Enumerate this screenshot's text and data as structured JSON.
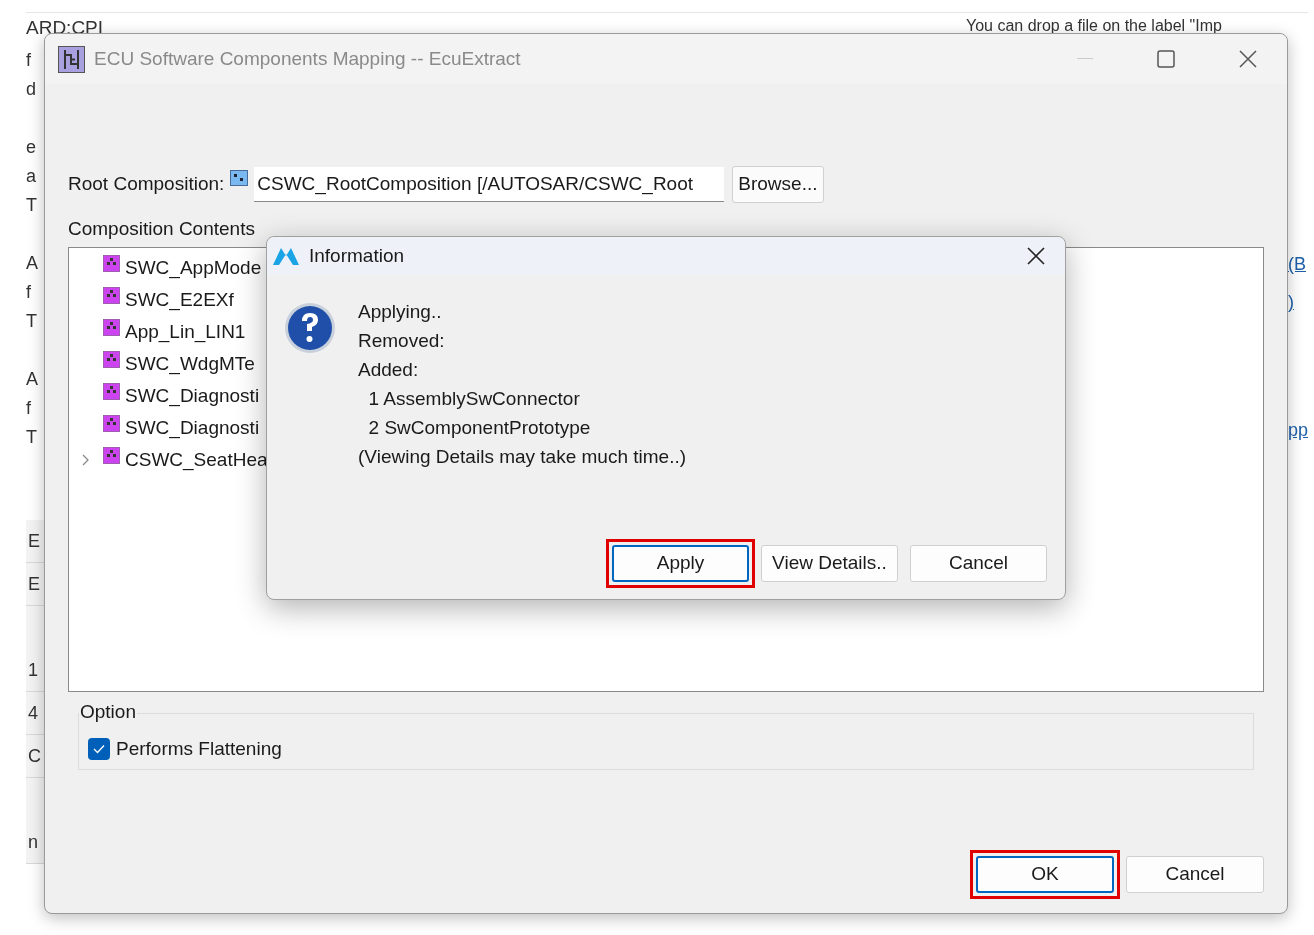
{
  "background": {
    "top_left": "ARD:CPI",
    "top_right": "You can drop a file on the label \"Imp",
    "left_groups": [
      [
        "f",
        "d"
      ],
      [
        "e",
        "a",
        "T"
      ],
      [
        "A",
        "f",
        "T"
      ],
      [
        "A",
        "f",
        "T"
      ]
    ],
    "left_lower_groups": [
      [
        "E",
        "E"
      ],
      [
        "1",
        "4",
        "C"
      ],
      [
        "n"
      ]
    ],
    "right_link_groups": [
      [
        "(B",
        ")"
      ],
      [
        "pp"
      ]
    ]
  },
  "window": {
    "title": "ECU Software Components Mapping -- EcuExtract",
    "root_label": "Root Composition:",
    "root_value": "CSWC_RootComposition [/AUTOSAR/CSWC_Root",
    "browse": "Browse...",
    "contents_label": "Composition Contents",
    "tree": [
      {
        "label": "SWC_AppMode",
        "expandable": false
      },
      {
        "label": "SWC_E2EXf",
        "expandable": false
      },
      {
        "label": "App_Lin_LIN1",
        "expandable": false
      },
      {
        "label": "SWC_WdgMTe",
        "expandable": false
      },
      {
        "label": "SWC_Diagnosti",
        "expandable": false
      },
      {
        "label": "SWC_Diagnosti",
        "expandable": false
      },
      {
        "label": "CSWC_SeatHea",
        "expandable": true
      }
    ],
    "option_title": "Option",
    "option": {
      "label": "Performs Flattening",
      "checked": true
    },
    "buttons": [
      {
        "label": "OK",
        "default": true,
        "highlighted": true
      },
      {
        "label": "Cancel",
        "default": false,
        "highlighted": false
      }
    ]
  },
  "dialog": {
    "title": "Information",
    "lines": [
      "Applying..",
      "Removed:",
      "Added:",
      "  1 AssemblySwConnector",
      "  2 SwComponentPrototype",
      "(Viewing Details may take much time..)"
    ],
    "buttons": [
      {
        "label": "Apply",
        "default": true,
        "highlighted": true
      },
      {
        "label": "View Details..",
        "default": false,
        "highlighted": false
      },
      {
        "label": "Cancel",
        "default": false,
        "highlighted": false
      }
    ]
  }
}
